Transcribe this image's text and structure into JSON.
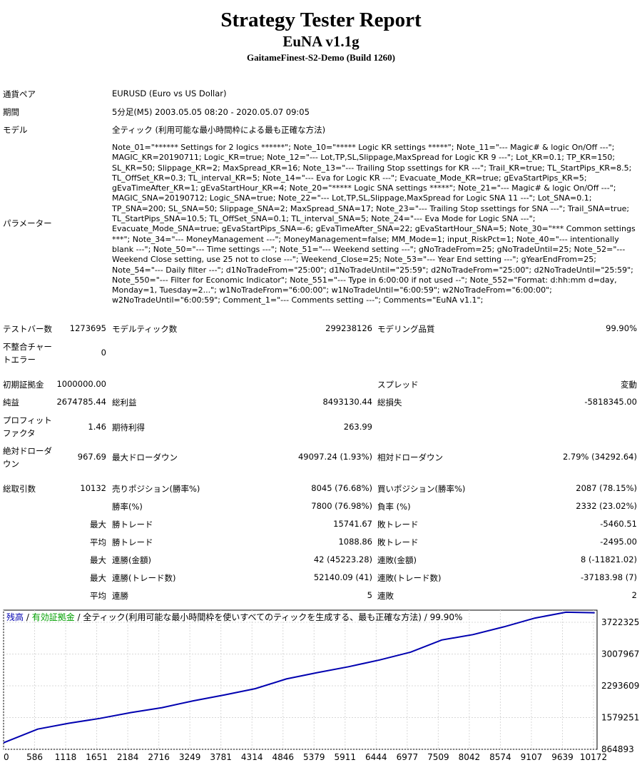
{
  "report": {
    "title": "Strategy Tester Report",
    "ea_name": "EuNA v1.1g",
    "server": "GaitameFinest-S2-Demo (Build 1260)"
  },
  "info": {
    "symbol_label": "通貨ペア",
    "symbol_value": "EURUSD (Euro vs US Dollar)",
    "period_label": "期間",
    "period_value": "5分足(M5) 2003.05.05 08:20 - 2020.05.07 09:05",
    "model_label": "モデル",
    "model_value": "全ティック (利用可能な最小時間枠による最も正確な方法)",
    "params_label": "パラメーター",
    "params_value": "Note_01=\"****** Settings for 2 logics ******\"; Note_10=\"***** Logic KR settings *****\"; Note_11=\"--- Magic# & logic On/Off ---\"; MAGIC_KR=20190711; Logic_KR=true; Note_12=\"--- Lot,TP,SL,Slippage,MaxSpread for Logic KR 9 ---\"; Lot_KR=0.1; TP_KR=150; SL_KR=50; Slippage_KR=2; MaxSpread_KR=16; Note_13=\"--- Trailing Stop ssettings for KR ---\"; Trail_KR=true; TL_StartPips_KR=8.5; TL_OffSet_KR=0.3; TL_interval_KR=5; Note_14=\"--- Eva for Logic KR ---\"; Evacuate_Mode_KR=true; gEvaStartPips_KR=5; gEvaTimeAfter_KR=1; gEvaStartHour_KR=4; Note_20=\"***** Logic SNA settings *****\"; Note_21=\"--- Magic# & logic On/Off ---\"; MAGIC_SNA=20190712; Logic_SNA=true; Note_22=\"--- Lot,TP,SL,Slippage,MaxSpread for Logic SNA 11 ---\"; Lot_SNA=0.1; TP_SNA=200; SL_SNA=50; Slippage_SNA=2; MaxSpread_SNA=17; Note_23=\"--- Trailing Stop ssettings for SNA ---\"; Trail_SNA=true; TL_StartPips_SNA=10.5; TL_OffSet_SNA=0.1; TL_interval_SNA=5; Note_24=\"--- Eva Mode for Logic SNA ---\"; Evacuate_Mode_SNA=true; gEvaStartPips_SNA=-6; gEvaTimeAfter_SNA=22; gEvaStartHour_SNA=5; Note_30=\"*** Common settings ***\"; Note_34=\"--- MoneyManagement ---\"; MoneyManagement=false; MM_Mode=1; input_RiskPct=1; Note_40=\"--- intentionally blank ---\"; Note_50=\"--- Time settings ---\"; Note_51=\"--- Weekend setting ---\"; gNoTradeFrom=25; gNoTradeUntil=25; Note_52=\"--- Weekend Close setting, use 25 not to close ---\"; Weekend_Close=25; Note_53=\"--- Year End setting ---\"; gYearEndFrom=25; Note_54=\"--- Daily filter ---\"; d1NoTradeFrom=\"25:00\"; d1NoTradeUntil=\"25:59\"; d2NoTradeFrom=\"25:00\"; d2NoTradeUntil=\"25:59\"; Note_550=\"--- Filter for Economic Indicator\"; Note_551=\"--- Type in 6:00:00 if not used --\"; Note_552=\"Format: d:hh:mm d=day, Monday=1, Tuesday=2...\"; w1NoTradeFrom=\"6:00:00\"; w1NoTradeUntil=\"6:00:59\"; w2NoTradeFrom=\"6:00:00\"; w2NoTradeUntil=\"6:00:59\"; Comment_1=\"--- Comments setting ---\"; Comments=\"EuNA v1.1\";"
  },
  "stats": {
    "bars_label": "テストバー数",
    "bars_value": "1273695",
    "ticks_label": "モデルティック数",
    "ticks_value": "299238126",
    "quality_label": "モデリング品質",
    "quality_value": "99.90%",
    "mismatch_label_1": "不整合チャー",
    "mismatch_label_2": "トエラー",
    "mismatch_value": "0",
    "deposit_label": "初期証拠金",
    "deposit_value": "1000000.00",
    "spread_label": "スプレッド",
    "spread_value": "変動",
    "net_label": "純益",
    "net_value": "2674785.44",
    "gross_profit_label": "総利益",
    "gross_profit_value": "8493130.44",
    "gross_loss_label": "総損失",
    "gross_loss_value": "-5818345.00",
    "pf_label_1": "プロフィット",
    "pf_label_2": "ファクタ",
    "pf_value": "1.46",
    "expected_label": "期待利得",
    "expected_value": "263.99",
    "abs_dd_label_1": "絶対ドローダ",
    "abs_dd_label_2": "ウン",
    "abs_dd_value": "967.69",
    "max_dd_label": "最大ドローダウン",
    "max_dd_value": "49097.24 (1.93%)",
    "rel_dd_label": "相対ドローダウン",
    "rel_dd_value": "2.79% (34292.64)",
    "total_label": "総取引数",
    "total_value": "10132",
    "short_label": "売りポジション(勝率%)",
    "short_value": "8045 (76.68%)",
    "long_label": "買いポジション(勝率%)",
    "long_value": "2087 (78.15%)",
    "win_rate_label": "勝率(%)",
    "win_rate_value": "7800 (76.98%)",
    "loss_rate_label": "負率 (%)",
    "loss_rate_value": "2332 (23.02%)",
    "max_word": "最大",
    "avg_word": "平均",
    "max_win_label": "勝トレード",
    "max_win_value": "15741.67",
    "max_loss_label": "敗トレード",
    "max_loss_value": "-5460.51",
    "avg_win_label": "勝トレード",
    "avg_win_value": "1088.86",
    "avg_loss_label": "敗トレード",
    "avg_loss_value": "-2495.00",
    "max_cw_label": "連勝(金額)",
    "max_cw_value": "42 (45223.28)",
    "max_cl_label": "連敗(金額)",
    "max_cl_value": "8 (-11821.02)",
    "max_cw2_label": "連勝(トレード数)",
    "max_cw2_value": "52140.09 (41)",
    "max_cl2_label": "連敗(トレード数)",
    "max_cl2_value": "-37183.98 (7)",
    "avg_cw_label": "連勝",
    "avg_cw_value": "5",
    "avg_cl_label": "連敗",
    "avg_cl_value": "2"
  },
  "chart_legend": {
    "balance": "残高",
    "sep1": " / ",
    "equity": "有効証拠金",
    "rest": " / 全ティック(利用可能な最小時間枠を使いすべてのティックを生成する、最も正確な方法) / 99.90%"
  },
  "colors": {
    "balance": "#0000b0",
    "equity": "#00a000",
    "grid": "#d8d8d8"
  },
  "chart_data": {
    "type": "line",
    "series": [
      {
        "name": "残高",
        "x": [
          0,
          586,
          1118,
          1651,
          2184,
          2716,
          3249,
          3781,
          4314,
          4846,
          5379,
          5911,
          6444,
          6977,
          7509,
          8042,
          8574,
          9107,
          9639,
          10132
        ],
        "values": [
          1000000,
          1280000,
          1400000,
          1500000,
          1620000,
          1720000,
          1860000,
          1980000,
          2110000,
          2310000,
          2440000,
          2560000,
          2700000,
          2860000,
          3110000,
          3220000,
          3380000,
          3560000,
          3680000,
          3670000
        ]
      }
    ],
    "y_ticks": [
      "3722325",
      "3007967",
      "2293609",
      "1579251",
      "864893"
    ],
    "x_ticks": [
      "0",
      "586",
      "1118",
      "1651",
      "2184",
      "2716",
      "3249",
      "3781",
      "4314",
      "4846",
      "5379",
      "5911",
      "6444",
      "6977",
      "7509",
      "8042",
      "8574",
      "9107",
      "9639",
      "10172"
    ],
    "ylim": [
      864893,
      3722325
    ],
    "xlim": [
      0,
      10172
    ],
    "grid": true
  }
}
